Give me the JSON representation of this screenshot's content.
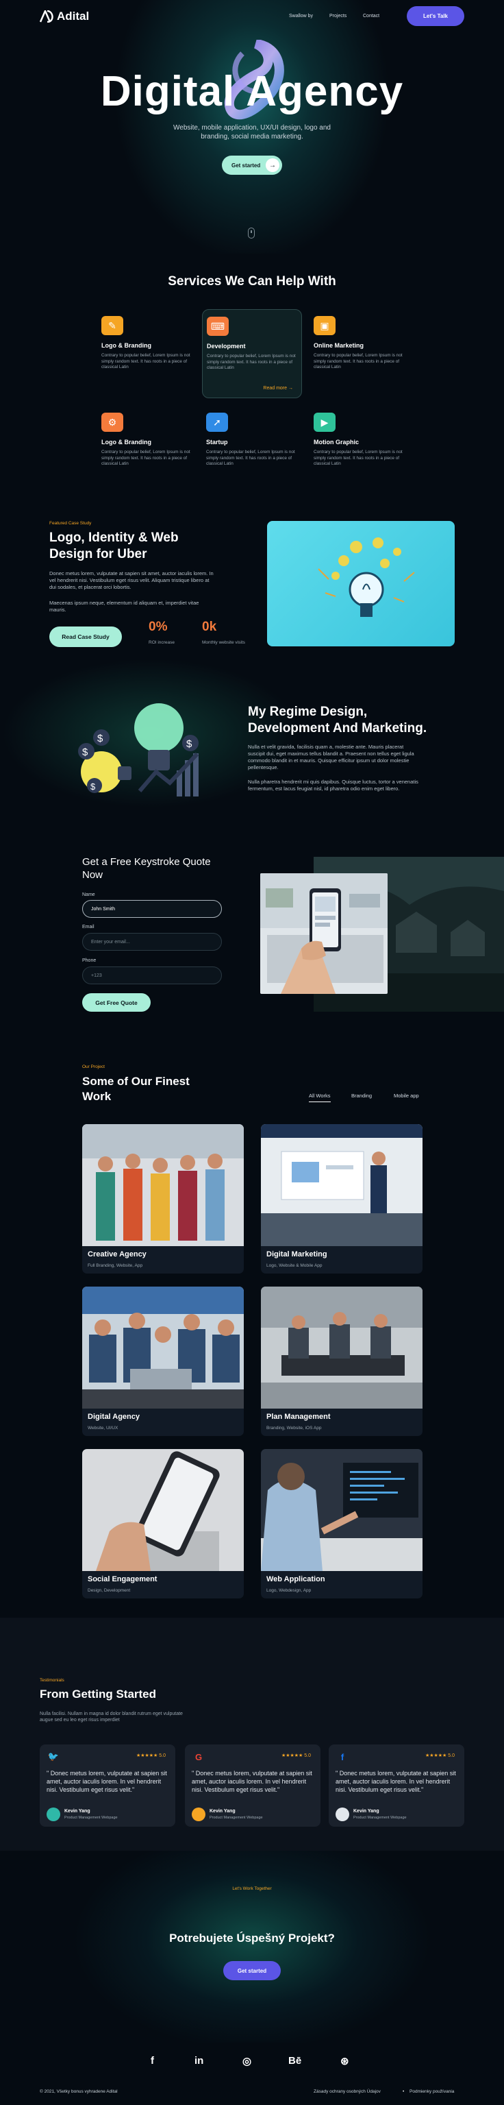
{
  "nav": {
    "brand": "Adital",
    "links": [
      "Swallow by",
      "Projects",
      "Contact"
    ],
    "cta": "Let's Talk"
  },
  "hero": {
    "title": "Digital Agency",
    "subtitle": "Website, mobile application, UX/UI design, logo and branding, social media marketing.",
    "cta": "Get started"
  },
  "services": {
    "title": "Services We Can Help With",
    "items": [
      {
        "title": "Logo & Branding",
        "desc": "Contrary to popular belief, Lorem Ipsum is not simply random text. It has roots in a piece of classical Latin",
        "color": "#f5a524",
        "icon": "brush-icon"
      },
      {
        "title": "Development",
        "desc": "Contrary to popular belief, Lorem Ipsum is not simply random text. It has roots in a piece of classical Latin",
        "color": "#f47b3c",
        "icon": "code-icon",
        "more": "Read more"
      },
      {
        "title": "Online Marketing",
        "desc": "Contrary to popular belief, Lorem Ipsum is not simply random text. It has roots in a piece of classical Latin",
        "color": "#f5a524",
        "icon": "monitor-icon"
      },
      {
        "title": "Logo & Branding",
        "desc": "Contrary to popular belief, Lorem Ipsum is not simply random text. It has roots in a piece of classical Latin",
        "color": "#f47b3c",
        "icon": "gear-icon"
      },
      {
        "title": "Startup",
        "desc": "Contrary to popular belief, Lorem Ipsum is not simply random text. It has roots in a piece of classical Latin",
        "color": "#2f8be6",
        "icon": "rocket-icon"
      },
      {
        "title": "Motion Graphic",
        "desc": "Contrary to popular belief, Lorem Ipsum is not simply random text. It has roots in a piece of classical Latin",
        "color": "#2fc39a",
        "icon": "play-icon"
      }
    ]
  },
  "case_study": {
    "label": "Featured Case Study",
    "title": "Logo, Identity & Web Design for Uber",
    "p1": "Donec metus lorem, vulputate at sapien sit amet, auctor iaculis lorem. In vel hendrerit nisi. Vestibulum eget risus velit. Aliquam tristique libero at dui sodales, et placerat orci lobortis.",
    "p2": "Maecenas ipsum neque, elementum id aliquam et, imperdiet vitae mauris.",
    "cta": "Read Case Study",
    "stats": [
      {
        "num": "0%",
        "label": "ROI increase"
      },
      {
        "num": "0k",
        "label": "Monthly website visits"
      }
    ]
  },
  "regime": {
    "title": "My Regime Design, Development And Marketing.",
    "p1": "Nulla et velit gravida, facilisis quam a, molestie ante. Mauris placerat suscipit dui, eget maximus tellus blandit a. Praesent non tellus eget ligula commodo blandit in et mauris. Quisque efficitur ipsum ut dolor molestie pellentesque.",
    "p2": "Nulla pharetra hendrerit mi quis dapibus. Quisque luctus, tortor a venenatis fermentum, est lacus feugiat nisl, id pharetra odio enim eget libero."
  },
  "quote": {
    "title": "Get a Free Keystroke Quote Now",
    "fields": [
      {
        "label": "Name",
        "value": "John Smith",
        "placeholder": ""
      },
      {
        "label": "Email",
        "value": "",
        "placeholder": "Enter your email..."
      },
      {
        "label": "Phone",
        "value": "",
        "placeholder": "+123"
      }
    ],
    "cta": "Get Free Quote"
  },
  "work": {
    "label": "Our Project",
    "title": "Some of Our Finest Work",
    "tabs": [
      "All Works",
      "Branding",
      "Mobile app"
    ],
    "items": [
      {
        "title": "Creative Agency",
        "tags": "Full Branding, Website, App"
      },
      {
        "title": "Digital Marketing",
        "tags": "Logo, Website & Mobile App"
      },
      {
        "title": "Digital Agency",
        "tags": "Website, UI/UX"
      },
      {
        "title": "Plan Management",
        "tags": "Branding, Website, iOS App"
      },
      {
        "title": "Social Engagement",
        "tags": "Design, Development"
      },
      {
        "title": "Web Application",
        "tags": "Logo, Webdesign, App"
      }
    ]
  },
  "testimonials": {
    "label": "Testimonials",
    "title": "From Getting Started",
    "desc": "Nulla facilisi. Nullam in magna id dolor blandit rutrum eget vulputate augue sed eu leo eget risus imperdiet",
    "items": [
      {
        "source": "twitter-icon",
        "rating": "★★★★★ 5.0",
        "quote": "\" Donec metus lorem, vulputate at sapien sit amet, auctor iaculis lorem. In vel hendrerit nisi. Vestibulum eget risus velit.\"",
        "name": "Kevin Yang",
        "role": "Product Management Webpage"
      },
      {
        "source": "google-icon",
        "rating": "★★★★★ 5.0",
        "quote": "\" Donec metus lorem, vulputate at sapien sit amet, auctor iaculis lorem. In vel hendrerit nisi. Vestibulum eget risus velit.\"",
        "name": "Kevin Yang",
        "role": "Product Management Webpage"
      },
      {
        "source": "facebook-icon",
        "rating": "★★★★★ 5.0",
        "quote": "\" Donec metus lorem, vulputate at sapien sit amet, auctor iaculis lorem. In vel hendrerit nisi. Vestibulum eget risus velit.\"",
        "name": "Kevin Yang",
        "role": "Product Management Webpage"
      }
    ]
  },
  "cta": {
    "label": "Let's Work Together",
    "title": "Potrebujete Úspešný Projekt?",
    "button": "Get started"
  },
  "social": [
    "f",
    "in",
    "◎",
    "Bē",
    "⊛"
  ],
  "footer": {
    "copyright": "© 2021, Všetky bonus vyhradene Adital",
    "links": [
      "Zásady ochrany osobných Údajov",
      "Podmienky používania"
    ]
  }
}
